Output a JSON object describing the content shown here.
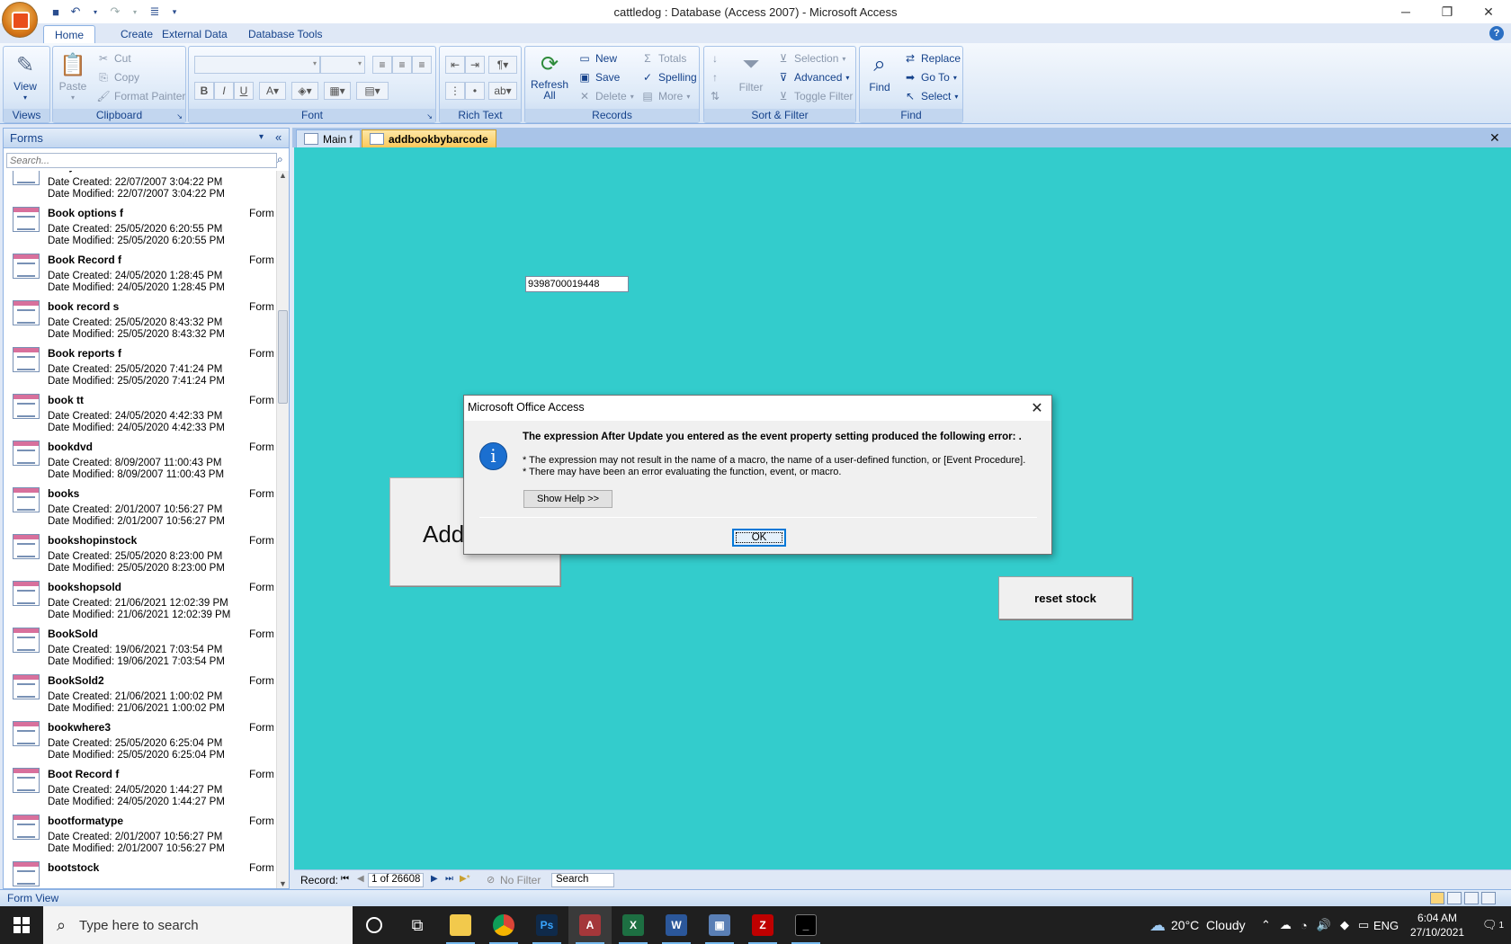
{
  "window": {
    "title": "cattledog : Database (Access 2007) - Microsoft Access"
  },
  "ribbon_tabs": [
    "Home",
    "Create",
    "External Data",
    "Database Tools"
  ],
  "ribbon": {
    "views": {
      "view": "View",
      "label": "Views"
    },
    "clipboard": {
      "paste": "Paste",
      "cut": "Cut",
      "copy": "Copy",
      "format_painter": "Format Painter",
      "label": "Clipboard"
    },
    "font": {
      "label": "Font"
    },
    "rich_text": {
      "label": "Rich Text"
    },
    "records": {
      "refresh": "Refresh All",
      "new": "New",
      "save": "Save",
      "delete": "Delete",
      "totals": "Totals",
      "spelling": "Spelling",
      "more": "More",
      "label": "Records"
    },
    "sort_filter": {
      "filter": "Filter",
      "selection": "Selection",
      "advanced": "Advanced",
      "toggle_filter": "Toggle Filter",
      "label": "Sort & Filter"
    },
    "find": {
      "find": "Find",
      "replace": "Replace",
      "goto": "Go To",
      "select": "Select",
      "label": "Find"
    }
  },
  "nav": {
    "title": "Forms",
    "search_placeholder": "Search...",
    "items": [
      {
        "name": "allviylistk",
        "type": "Form",
        "created": "Date Created: 22/07/2007 3:04:22 PM",
        "modified": "Date Modified: 22/07/2007 3:04:22 PM"
      },
      {
        "name": "Book options f",
        "type": "Form",
        "created": "Date Created: 25/05/2020 6:20:55 PM",
        "modified": "Date Modified: 25/05/2020 6:20:55 PM"
      },
      {
        "name": "Book Record f",
        "type": "Form",
        "created": "Date Created: 24/05/2020 1:28:45 PM",
        "modified": "Date Modified: 24/05/2020 1:28:45 PM"
      },
      {
        "name": "book record s",
        "type": "Form",
        "created": "Date Created: 25/05/2020 8:43:32 PM",
        "modified": "Date Modified: 25/05/2020 8:43:32 PM"
      },
      {
        "name": "Book reports f",
        "type": "Form",
        "created": "Date Created: 25/05/2020 7:41:24 PM",
        "modified": "Date Modified: 25/05/2020 7:41:24 PM"
      },
      {
        "name": "book tt",
        "type": "Form",
        "created": "Date Created: 24/05/2020 4:42:33 PM",
        "modified": "Date Modified: 24/05/2020 4:42:33 PM"
      },
      {
        "name": "bookdvd",
        "type": "Form",
        "created": "Date Created: 8/09/2007 11:00:43 PM",
        "modified": "Date Modified: 8/09/2007 11:00:43 PM"
      },
      {
        "name": "books",
        "type": "Form",
        "created": "Date Created: 2/01/2007 10:56:27 PM",
        "modified": "Date Modified: 2/01/2007 10:56:27 PM"
      },
      {
        "name": "bookshopinstock",
        "type": "Form",
        "created": "Date Created: 25/05/2020 8:23:00 PM",
        "modified": "Date Modified: 25/05/2020 8:23:00 PM"
      },
      {
        "name": "bookshopsold",
        "type": "Form",
        "created": "Date Created: 21/06/2021 12:02:39 PM",
        "modified": "Date Modified: 21/06/2021 12:02:39 PM"
      },
      {
        "name": "BookSold",
        "type": "Form",
        "created": "Date Created: 19/06/2021 7:03:54 PM",
        "modified": "Date Modified: 19/06/2021 7:03:54 PM"
      },
      {
        "name": "BookSold2",
        "type": "Form",
        "created": "Date Created: 21/06/2021 1:00:02 PM",
        "modified": "Date Modified: 21/06/2021 1:00:02 PM"
      },
      {
        "name": "bookwhere3",
        "type": "Form",
        "created": "Date Created: 25/05/2020 6:25:04 PM",
        "modified": "Date Modified: 25/05/2020 6:25:04 PM"
      },
      {
        "name": "Boot Record f",
        "type": "Form",
        "created": "Date Created: 24/05/2020 1:44:27 PM",
        "modified": "Date Modified: 24/05/2020 1:44:27 PM"
      },
      {
        "name": "bootformatype",
        "type": "Form",
        "created": "Date Created: 2/01/2007 10:56:27 PM",
        "modified": "Date Modified: 2/01/2007 10:56:27 PM"
      },
      {
        "name": "bootstock",
        "type": "Form",
        "created": "",
        "modified": ""
      }
    ]
  },
  "doc_tabs": [
    "Main f",
    "addbookbybarcode"
  ],
  "form": {
    "barcode_value": "9398700019448",
    "add_button": "Add",
    "reset_button": "reset stock"
  },
  "record_bar": {
    "label": "Record:",
    "current": "1 of 26608",
    "filter": "No Filter",
    "search": "Search"
  },
  "status": {
    "text": "Form View"
  },
  "dialog": {
    "title": "Microsoft Office Access",
    "heading": "The expression After Update you entered as the event property setting produced the following error: .",
    "line1": "* The expression may not result in the name of a macro, the name of a user-defined function, or [Event Procedure].",
    "line2": "* There may have been an error evaluating the function, event, or macro.",
    "help_button": "Show Help >>",
    "ok_button": "OK"
  },
  "taskbar": {
    "search_placeholder": "Type here to search",
    "weather": "20°C  Cloudy",
    "lang": "ENG",
    "time": "6:04 AM",
    "date": "27/10/2021",
    "notifications": "1"
  }
}
